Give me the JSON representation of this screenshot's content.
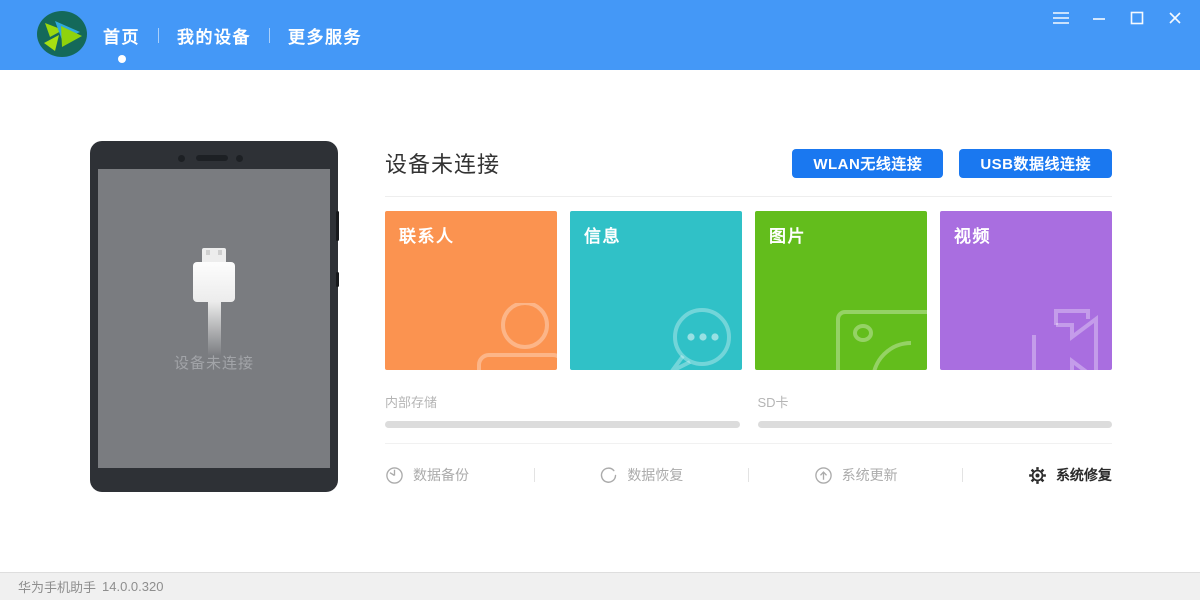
{
  "colors": {
    "header_bg": "#4498F7",
    "accent_button": "#1A78F0",
    "tile_contacts": "#FB9350",
    "tile_messages": "#30C1C7",
    "tile_pictures": "#63BD1C",
    "tile_videos": "#A96EE0"
  },
  "header": {
    "logo_icon": "hisuite-logo",
    "nav": [
      {
        "label": "首页",
        "active": true
      },
      {
        "label": "我的设备",
        "active": false
      },
      {
        "label": "更多服务",
        "active": false
      }
    ],
    "window_controls": [
      {
        "icon": "menu-icon"
      },
      {
        "icon": "minimize-icon"
      },
      {
        "icon": "maximize-icon"
      },
      {
        "icon": "close-icon"
      }
    ]
  },
  "phone": {
    "status_text": "设备未连接",
    "plug_icon": "usb-plug-icon"
  },
  "main": {
    "title": "设备未连接",
    "connect_buttons": [
      {
        "label": "WLAN无线连接"
      },
      {
        "label": "USB数据线连接"
      }
    ],
    "tiles": [
      {
        "label": "联系人",
        "color": "#FB9350",
        "icon": "contacts-icon"
      },
      {
        "label": "信息",
        "color": "#30C1C7",
        "icon": "messages-icon"
      },
      {
        "label": "图片",
        "color": "#63BD1C",
        "icon": "pictures-icon"
      },
      {
        "label": "视频",
        "color": "#A96EE0",
        "icon": "videos-icon"
      }
    ],
    "storage": [
      {
        "label": "内部存储"
      },
      {
        "label": "SD卡"
      }
    ],
    "actions": [
      {
        "label": "数据备份",
        "icon": "backup-icon",
        "enabled": false
      },
      {
        "label": "数据恢复",
        "icon": "restore-icon",
        "enabled": false
      },
      {
        "label": "系统更新",
        "icon": "update-icon",
        "enabled": false
      },
      {
        "label": "系统修复",
        "icon": "repair-icon",
        "enabled": true
      }
    ]
  },
  "footer": {
    "app_name": "华为手机助手",
    "version": "14.0.0.320"
  }
}
